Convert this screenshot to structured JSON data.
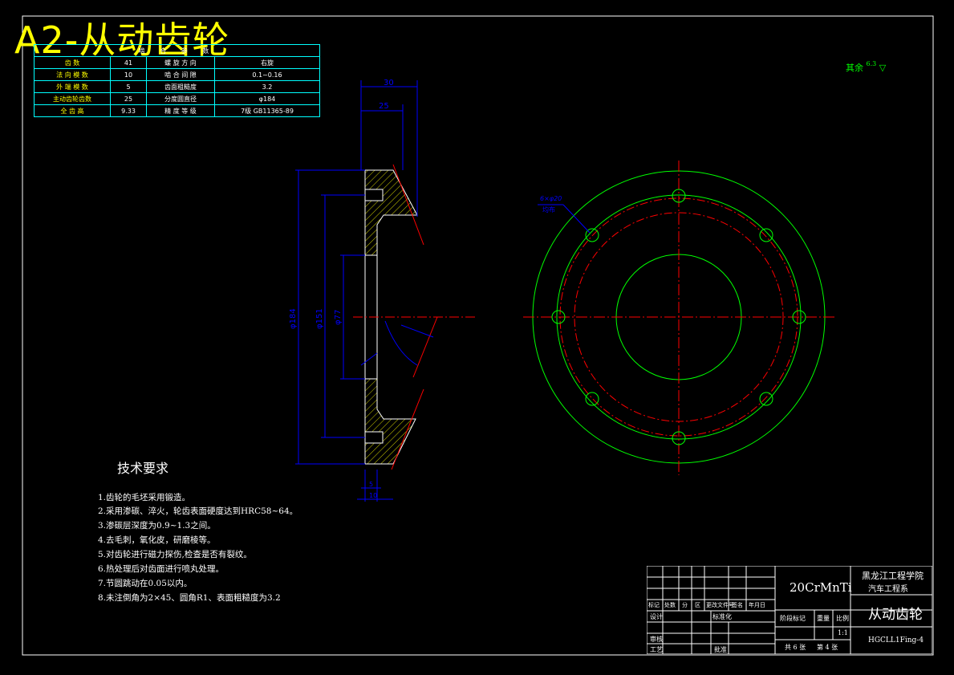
{
  "sheet_title": "A2-从动齿轮",
  "params_table": {
    "header": [
      "啮",
      "合",
      "参",
      "数"
    ],
    "rows": [
      [
        "齿",
        "数",
        "41",
        "螺",
        "旋",
        "方",
        "向",
        "右旋"
      ],
      [
        "法",
        "向",
        "模",
        "数",
        "10",
        "啮",
        "合",
        "间",
        "隙",
        "0.1~0.16"
      ],
      [
        "外",
        "端",
        "模",
        "数",
        "5",
        "齿",
        "面",
        "粗",
        "糙",
        "度",
        "3.2"
      ],
      [
        "主",
        "动",
        "齿",
        "轮",
        "齿",
        "数",
        "25",
        "分",
        "度",
        "圆",
        "直",
        "径",
        "φ184"
      ],
      [
        "全",
        "齿",
        "高",
        "9.33",
        "精",
        "度",
        "等",
        "级",
        "7级",
        "GB11365-89"
      ]
    ],
    "rows_display": [
      {
        "a": "齿      数",
        "b": "41",
        "c": "螺 旋 方 向",
        "d": "右旋"
      },
      {
        "a": "法 向 模 数",
        "b": "10",
        "c": "啮 合 间 隙",
        "d": "0.1~0.16"
      },
      {
        "a": "外 端 模 数",
        "b": "5",
        "c": "齿面粗糙度",
        "d": "3.2"
      },
      {
        "a": "主动齿轮齿数",
        "b": "25",
        "c": "分度圆直径",
        "d": "φ184"
      },
      {
        "a": "全  齿  高",
        "b": "9.33",
        "c": "精 度 等 级",
        "d": "7级  GB11365-89"
      }
    ]
  },
  "roughness_note": {
    "label": "其余",
    "value": "6.3"
  },
  "dims": {
    "d30": "30",
    "d25": "25",
    "d184": "φ184",
    "d151": "φ151",
    "d77": "φ77",
    "hole_label_1": "6×φ20",
    "hole_label_2": "均布",
    "d5": "5",
    "d10": "10"
  },
  "tech_requirements": {
    "title": "技术要求",
    "items": [
      "1.齿轮的毛坯采用锻造。",
      "2.采用渗碳、淬火，轮齿表面硬度达到HRC58~64。",
      "3.渗碳层深度为0.9~1.3之间。",
      "4.去毛刺，氧化皮，研磨棱等。",
      "5.对齿轮进行磁力探伤,检查是否有裂纹。",
      "6.热处理后对齿面进行喷丸处理。",
      "7.节圆跳动在0.05以内。",
      "8.未注倒角为2×45、圆角R1、表面粗糙度为3.2"
    ]
  },
  "title_block": {
    "material": "20CrMnTi",
    "school": "黑龙江工程学院",
    "department": "汽车工程系",
    "part_name": "从动齿轮",
    "drawing_no": "HGCLL1Fing-4",
    "scale": "1:1",
    "headers": [
      "标记",
      "处数",
      "分",
      "区",
      "更改文件号",
      "签名",
      "年月日"
    ],
    "design": "设计",
    "standard": "标准化",
    "stage_mark": "阶段标记",
    "weight": "重量",
    "ratio": "比例",
    "review": "审核",
    "process": "工艺",
    "approve": "批准",
    "sheets_total": "共 6 张",
    "sheet_no": "第 4 张"
  },
  "colors": {
    "outline": "#ffffff",
    "dim": "#0000ff",
    "center": "#ff0000",
    "green": "#00ff00",
    "cyan": "#00ffff",
    "yellow": "#ffff00"
  }
}
